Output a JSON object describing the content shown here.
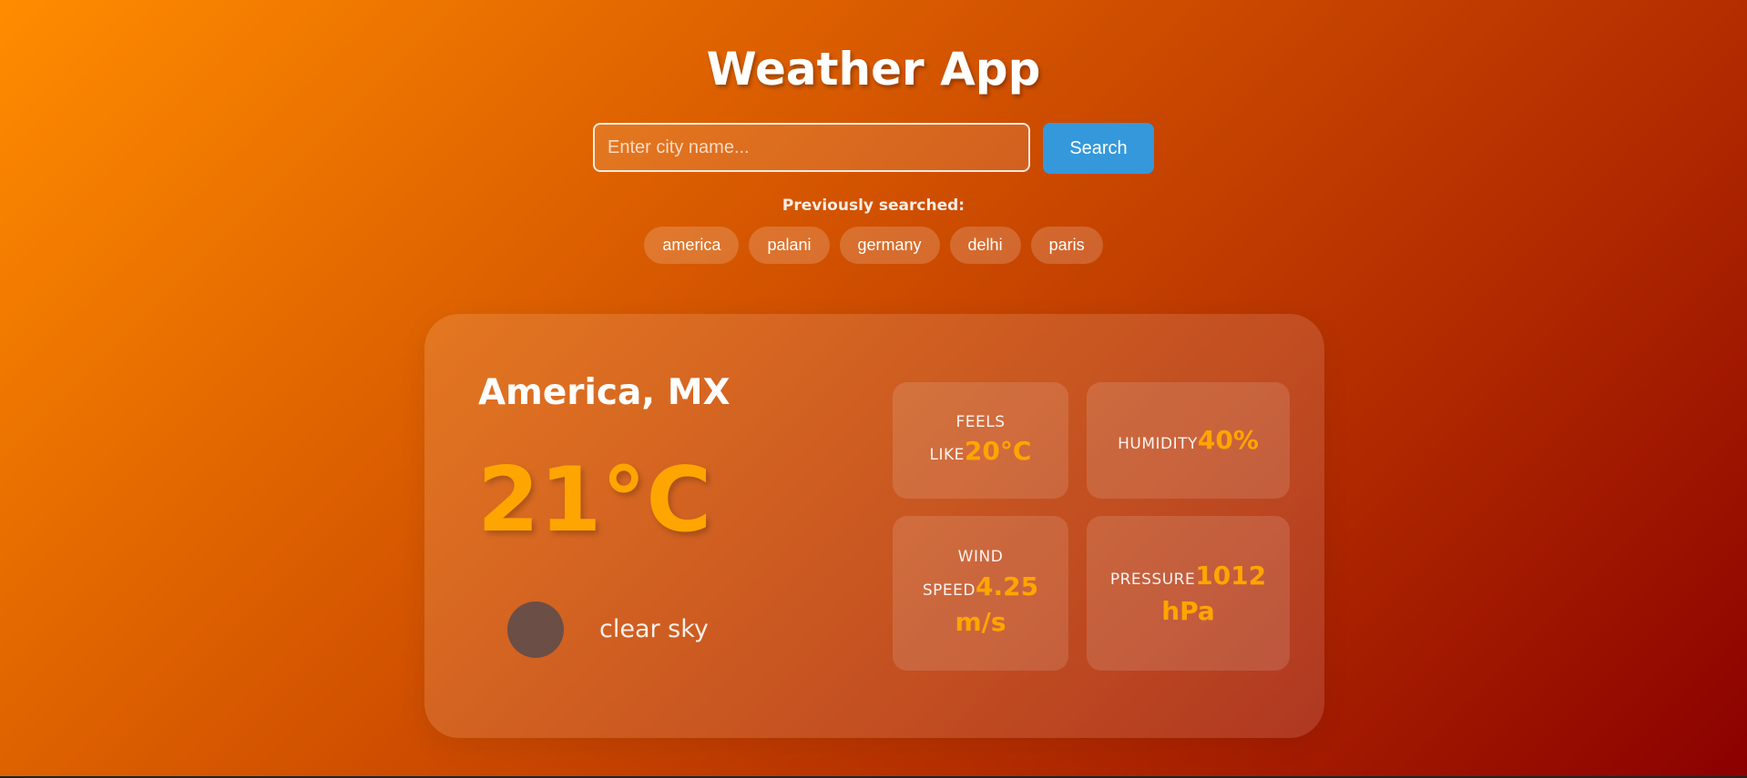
{
  "app": {
    "title": "Weather App"
  },
  "search": {
    "placeholder": "Enter city name...",
    "value": "",
    "button_label": "Search"
  },
  "history": {
    "label": "Previously searched:",
    "items": [
      "america",
      "palani",
      "germany",
      "delhi",
      "paris"
    ]
  },
  "weather": {
    "city": "America, MX",
    "temperature": "21°C",
    "icon": "weather-icon",
    "description": "clear sky",
    "stats": {
      "feels_like": {
        "label": "Feels like",
        "value": "20°C"
      },
      "humidity": {
        "label": "Humidity",
        "value": "40%"
      },
      "wind_speed": {
        "label": "Wind speed",
        "value": "4.25 m/s"
      },
      "pressure": {
        "label": "Pressure",
        "value": "1012 hPa"
      }
    }
  },
  "colors": {
    "accent": "#ffa500",
    "button": "#3498db",
    "gradient_start": "#ff8c00",
    "gradient_end": "#8b0000"
  }
}
